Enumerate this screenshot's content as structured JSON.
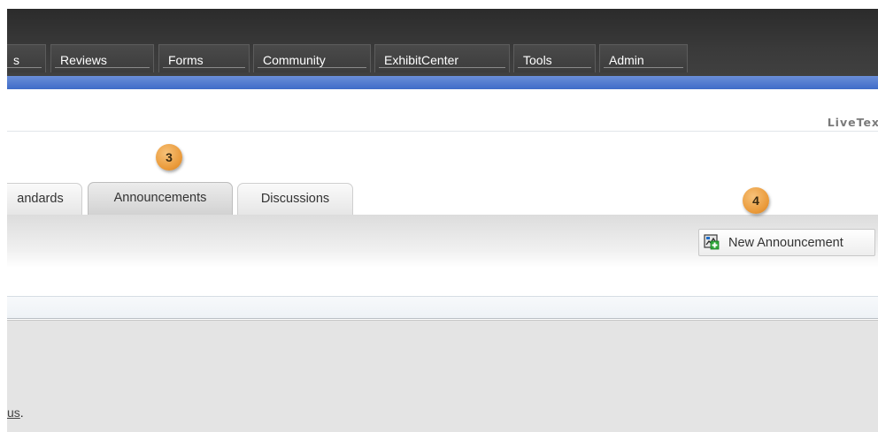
{
  "top_nav": {
    "items": [
      "s",
      "Reviews",
      "Forms",
      "Community",
      "ExhibitCenter",
      "Tools",
      "Admin"
    ]
  },
  "brand": {
    "name": "LiveTex"
  },
  "tabs": [
    {
      "label": "andards",
      "active": false
    },
    {
      "label": "Announcements",
      "active": true
    },
    {
      "label": "Discussions",
      "active": false
    }
  ],
  "toolbar": {
    "new_announcement_label": "New Announcement",
    "new_announcement_icon": "new-announcement-icon"
  },
  "content": {
    "link_fragment": "us",
    "trailing_text": "."
  },
  "callouts": {
    "tabs_marker": "3",
    "button_marker": "4"
  },
  "colors": {
    "accent_blue": "#3f6cc8",
    "topbar": "#333333",
    "callout_orange": "#ea9a3a"
  }
}
